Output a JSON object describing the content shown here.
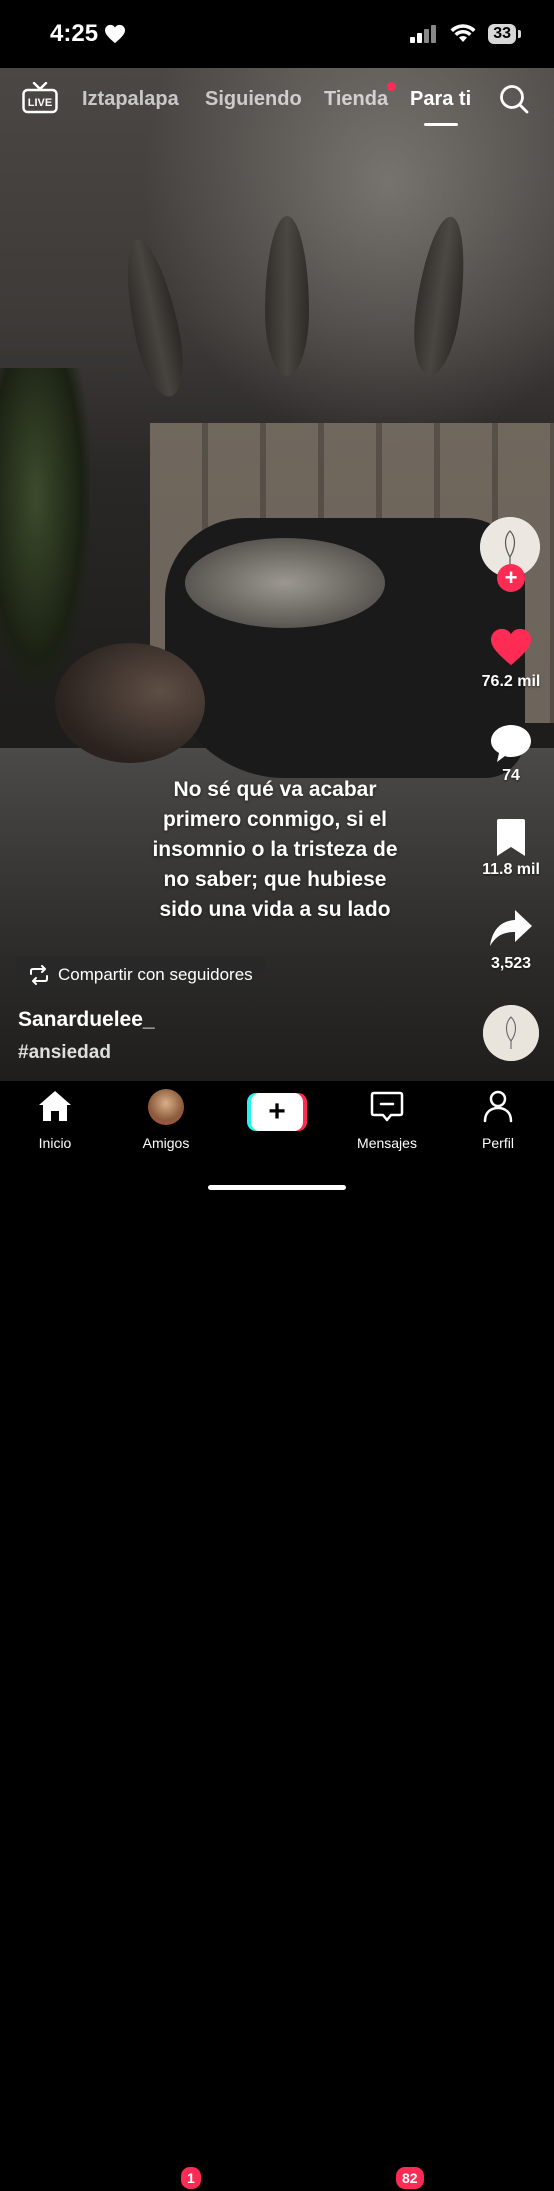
{
  "status_bar": {
    "time": "4:25",
    "battery": "33"
  },
  "top_nav": {
    "live_label": "LIVE",
    "tabs": [
      "Iztapalapa",
      "Siguiendo",
      "Tienda",
      "Para ti"
    ],
    "active_tab": "Para ti"
  },
  "caption": {
    "lines": [
      "No sé qué va acabar",
      "primero conmigo, si el",
      "insomnio o la tristeza de",
      "no saber; que hubiese",
      "sido una vida a su lado"
    ]
  },
  "actions": {
    "likes": "76.2 mil",
    "comments": "74",
    "bookmarks": "11.8 mil",
    "shares": "3,523"
  },
  "share_chip": {
    "label": "Compartir con seguidores"
  },
  "post": {
    "username": "Sanarduelee_",
    "hashtag": "#ansiedad"
  },
  "bottom_nav": {
    "items": [
      {
        "label": "Inicio",
        "icon": "home-icon",
        "active": true
      },
      {
        "label": "Amigos",
        "icon": "avatar",
        "badge": "1"
      },
      {
        "label": "",
        "icon": "create-plus-icon"
      },
      {
        "label": "Mensajes",
        "icon": "inbox-icon",
        "badge": "82"
      },
      {
        "label": "Perfil",
        "icon": "profile-icon"
      }
    ]
  },
  "colors": {
    "accent": "#fe2c55",
    "cyan": "#25f4ee"
  }
}
